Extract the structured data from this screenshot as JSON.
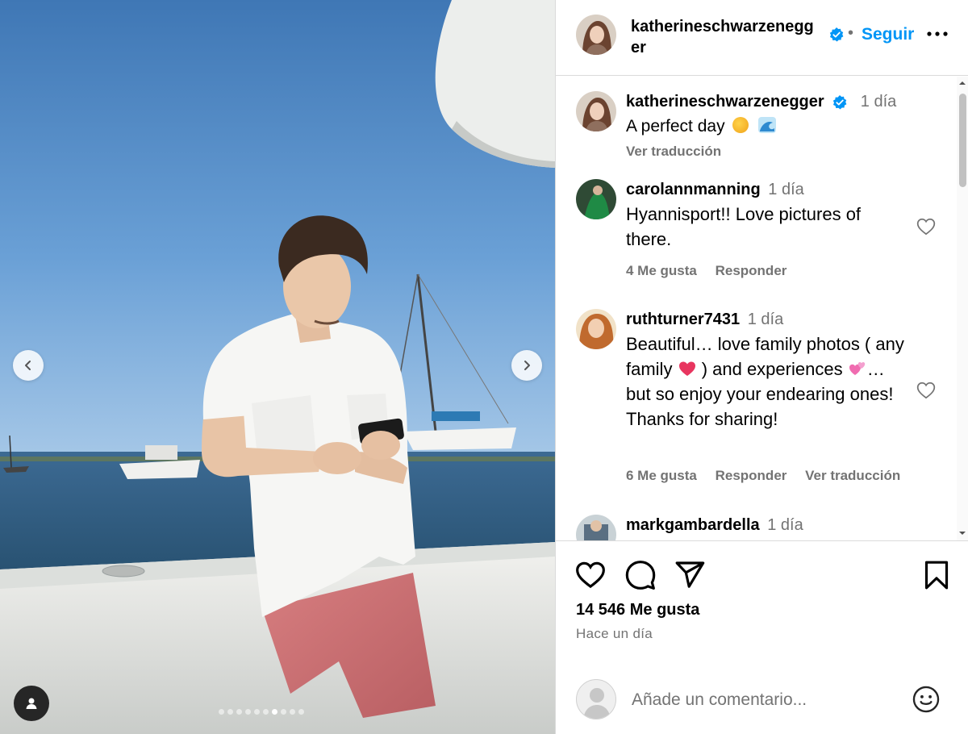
{
  "post": {
    "author": "katherineschwarzenegger",
    "follow_label": "Seguir",
    "separator": "•",
    "more_icon": "more-horizontal-icon"
  },
  "photo": {
    "carousel_dots": 10,
    "active_dot": 7,
    "prev_icon": "chevron-left-icon",
    "next_icon": "chevron-right-icon",
    "tag_icon": "user-tag-icon"
  },
  "caption": {
    "username": "katherineschwarzenegger",
    "time": "1 día",
    "text": "A perfect day",
    "emojis": [
      "sun-emoji",
      "wave-emoji"
    ],
    "translate_label": "Ver traducción"
  },
  "comments": [
    {
      "username": "carolannmanning",
      "time": "1 día",
      "text": "Hyannisport!! Love pictures of there.",
      "likes": "4 Me gusta",
      "reply": "Responder"
    },
    {
      "username": "ruthturner7431",
      "time": "1 día",
      "text_part1": "Beautiful… love family photos ( any family",
      "text_part2": " ) and experiences",
      "text_part3": "…but so enjoy your endearing ones! Thanks for sharing!",
      "likes": "6 Me gusta",
      "reply": "Responder",
      "translate": "Ver traducción"
    },
    {
      "username": "markgambardella",
      "time": "1 día"
    }
  ],
  "actions": {
    "like_icon": "heart-icon",
    "comment_icon": "comment-icon",
    "share_icon": "send-icon",
    "save_icon": "bookmark-icon",
    "likes_count": "14 546 Me gusta",
    "posted": "Hace un día"
  },
  "add_comment": {
    "placeholder": "Añade un comentario...",
    "emoji_icon": "smiley-icon"
  },
  "colors": {
    "accent": "#0095f6",
    "muted": "#737373",
    "border": "#dbdbdb",
    "verified": "#0095f6"
  }
}
